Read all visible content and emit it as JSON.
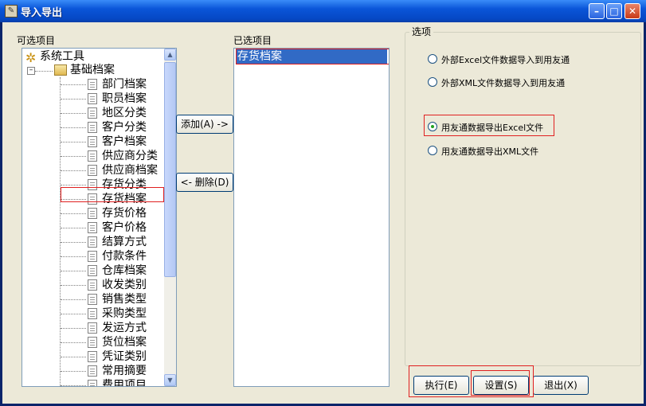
{
  "window": {
    "title": "导入导出"
  },
  "available": {
    "label": "可选项目",
    "root": "系统工具",
    "folder": "基础档案",
    "items": [
      "部门档案",
      "职员档案",
      "地区分类",
      "客户分类",
      "客户档案",
      "供应商分类",
      "供应商档案",
      "存货分类",
      "存货档案",
      "存货价格",
      "客户价格",
      "结算方式",
      "付款条件",
      "仓库档案",
      "收发类别",
      "销售类型",
      "采购类型",
      "发运方式",
      "货位档案",
      "凭证类别",
      "常用摘要",
      "费用项目"
    ],
    "selected_item": "存货档案"
  },
  "selected": {
    "label": "已选项目",
    "items": [
      "存货档案"
    ]
  },
  "buttons": {
    "add": "添加(A) ->",
    "delete": "<- 删除(D)",
    "execute": "执行(E)",
    "settings": "设置(S)",
    "exit": "退出(X)"
  },
  "options": {
    "label": "选项",
    "items": [
      {
        "label": "外部Excel文件数据导入到用友通",
        "checked": false
      },
      {
        "label": "外部XML文件数据导入到用友通",
        "checked": false
      },
      {
        "label": "用友通数据导出Excel文件",
        "checked": true
      },
      {
        "label": "用友通数据导出XML文件",
        "checked": false
      }
    ]
  }
}
